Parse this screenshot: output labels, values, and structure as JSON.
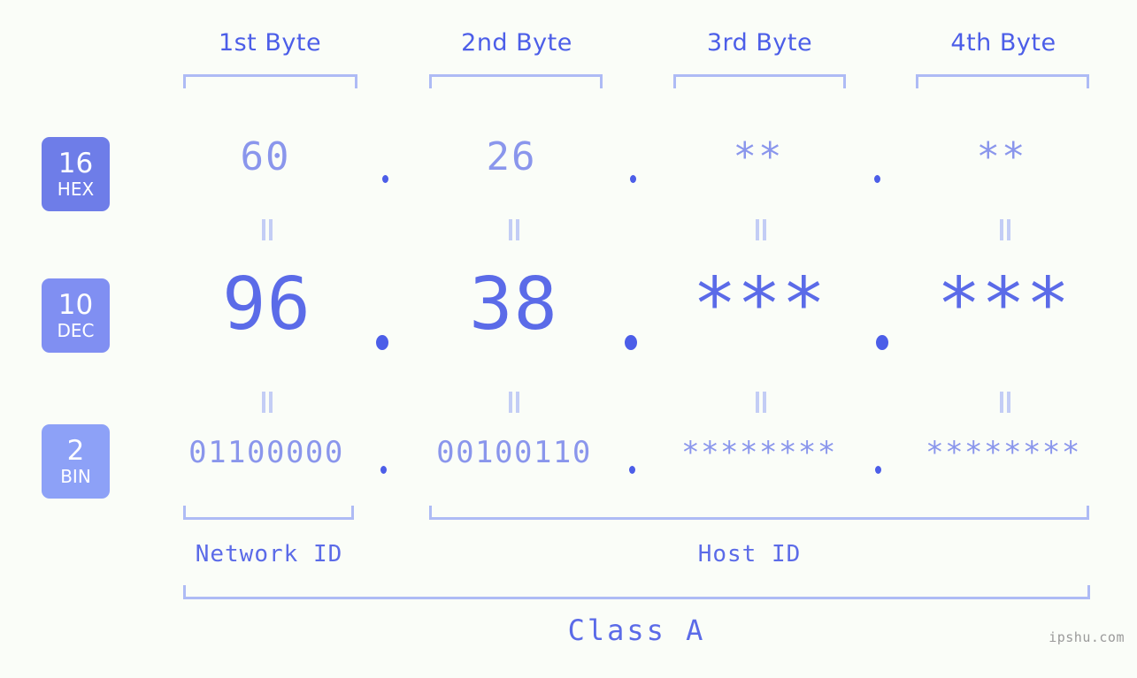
{
  "background_color": "#fafdf8",
  "accent_colors": {
    "header_text": "#4c5ee8",
    "bracket": "#aebbf5",
    "hex_value": "#8a96ec",
    "dec_value": "#5b6be8",
    "bin_value": "#8a96ec",
    "eq_bar": "#c3cdf5",
    "badge_hex": "#6e7de8",
    "badge_dec": "#808ff2",
    "badge_bin": "#8da1f7",
    "dot": "#4c5ee8",
    "watermark": "#9a9a9a"
  },
  "byte_headers": [
    {
      "label": "1st Byte"
    },
    {
      "label": "2nd Byte"
    },
    {
      "label": "3rd Byte"
    },
    {
      "label": "4th Byte"
    }
  ],
  "radix_badges": [
    {
      "number": "16",
      "abbr": "HEX"
    },
    {
      "number": "10",
      "abbr": "DEC"
    },
    {
      "number": "2",
      "abbr": "BIN"
    }
  ],
  "rows": {
    "hex": {
      "radix": "16",
      "name": "HEX",
      "values": [
        "60",
        "26",
        "**",
        "**"
      ],
      "separator": "."
    },
    "dec": {
      "radix": "10",
      "name": "DEC",
      "values": [
        "96",
        "38",
        "***",
        "***"
      ],
      "separator": "."
    },
    "bin": {
      "radix": "2",
      "name": "BIN",
      "values": [
        "01100000",
        "00100110",
        "********",
        "********"
      ],
      "separator": "."
    }
  },
  "equality_symbol": "=",
  "sections": {
    "network_id": "Network ID",
    "host_id": "Host ID",
    "class": "Class A"
  },
  "watermark": "ipshu.com"
}
